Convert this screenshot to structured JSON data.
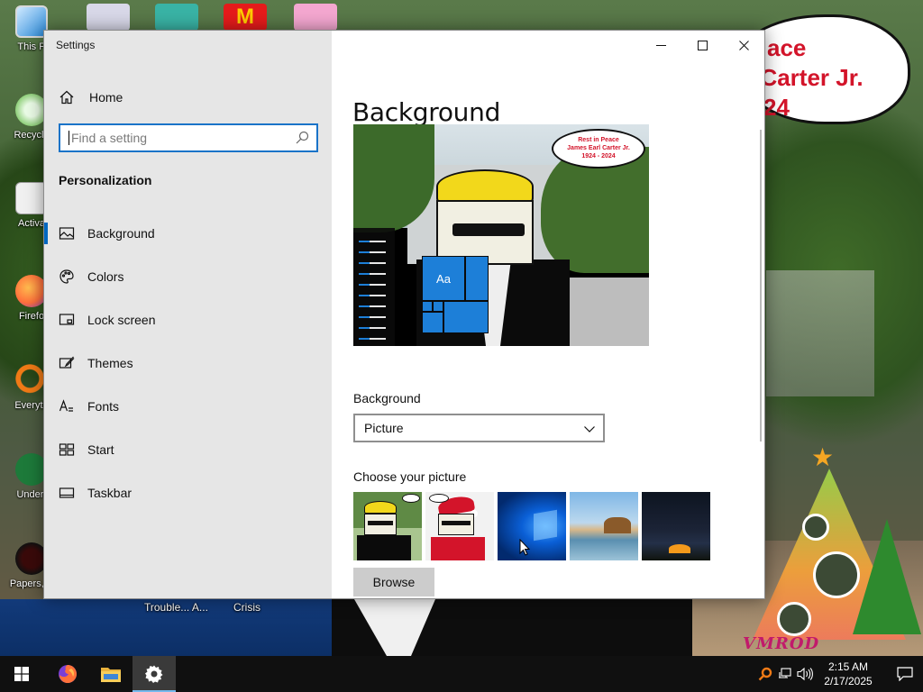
{
  "colors": {
    "accent": "#0067c0",
    "search_border": "#1a73c8",
    "sidebar_bg": "#e6e6e6",
    "taskbar_bg": "#101010",
    "wallpaper_text": "#d3142a"
  },
  "desktop": {
    "icons": [
      {
        "label": "This P",
        "icon": "this-pc-icon"
      },
      {
        "label": "Recycle",
        "icon": "recycle-bin-icon"
      },
      {
        "label": "Activa",
        "icon": "activator-icon"
      },
      {
        "label": "Firefo",
        "icon": "firefox-icon"
      },
      {
        "label": "Everyth",
        "icon": "everything-search-icon"
      },
      {
        "label": "Undert",
        "icon": "undertale-icon"
      },
      {
        "label": "Papers, P",
        "icon": "papers-please-icon"
      }
    ],
    "partial_labels": [
      "Trouble... A...",
      "Crisis"
    ],
    "wallpaper_text": [
      "ace",
      "l Carter Jr.",
      "24"
    ]
  },
  "window": {
    "title": "Settings",
    "controls": {
      "minimize": "minimize-icon",
      "maximize": "maximize-icon",
      "close": "close-icon"
    }
  },
  "sidebar": {
    "home_label": "Home",
    "search": {
      "placeholder": "Find a setting",
      "value": ""
    },
    "section_title": "Personalization",
    "items": [
      {
        "label": "Background",
        "icon": "picture-icon",
        "active": true
      },
      {
        "label": "Colors",
        "icon": "palette-icon",
        "active": false
      },
      {
        "label": "Lock screen",
        "icon": "lock-screen-icon",
        "active": false
      },
      {
        "label": "Themes",
        "icon": "brush-icon",
        "active": false
      },
      {
        "label": "Fonts",
        "icon": "font-icon",
        "active": false
      },
      {
        "label": "Start",
        "icon": "start-tiles-icon",
        "active": false
      },
      {
        "label": "Taskbar",
        "icon": "taskbar-icon",
        "active": false
      }
    ]
  },
  "main": {
    "title": "Background",
    "preview": {
      "tile_label": "Aa",
      "bubble_lines": [
        "Rest in Peace",
        "James Earl Carter Jr.",
        "1924 - 2024"
      ]
    },
    "background_label": "Background",
    "background_select": {
      "value": "Picture"
    },
    "choose_label": "Choose your picture",
    "browse_label": "Browse"
  },
  "taskbar": {
    "apps": [
      "windows-start-icon",
      "firefox-icon",
      "file-explorer-icon",
      "settings-gear-icon"
    ],
    "tray": [
      "everything-search-icon",
      "network-icon",
      "volume-icon"
    ],
    "time": "2:15 AM",
    "date": "2/17/2025"
  }
}
